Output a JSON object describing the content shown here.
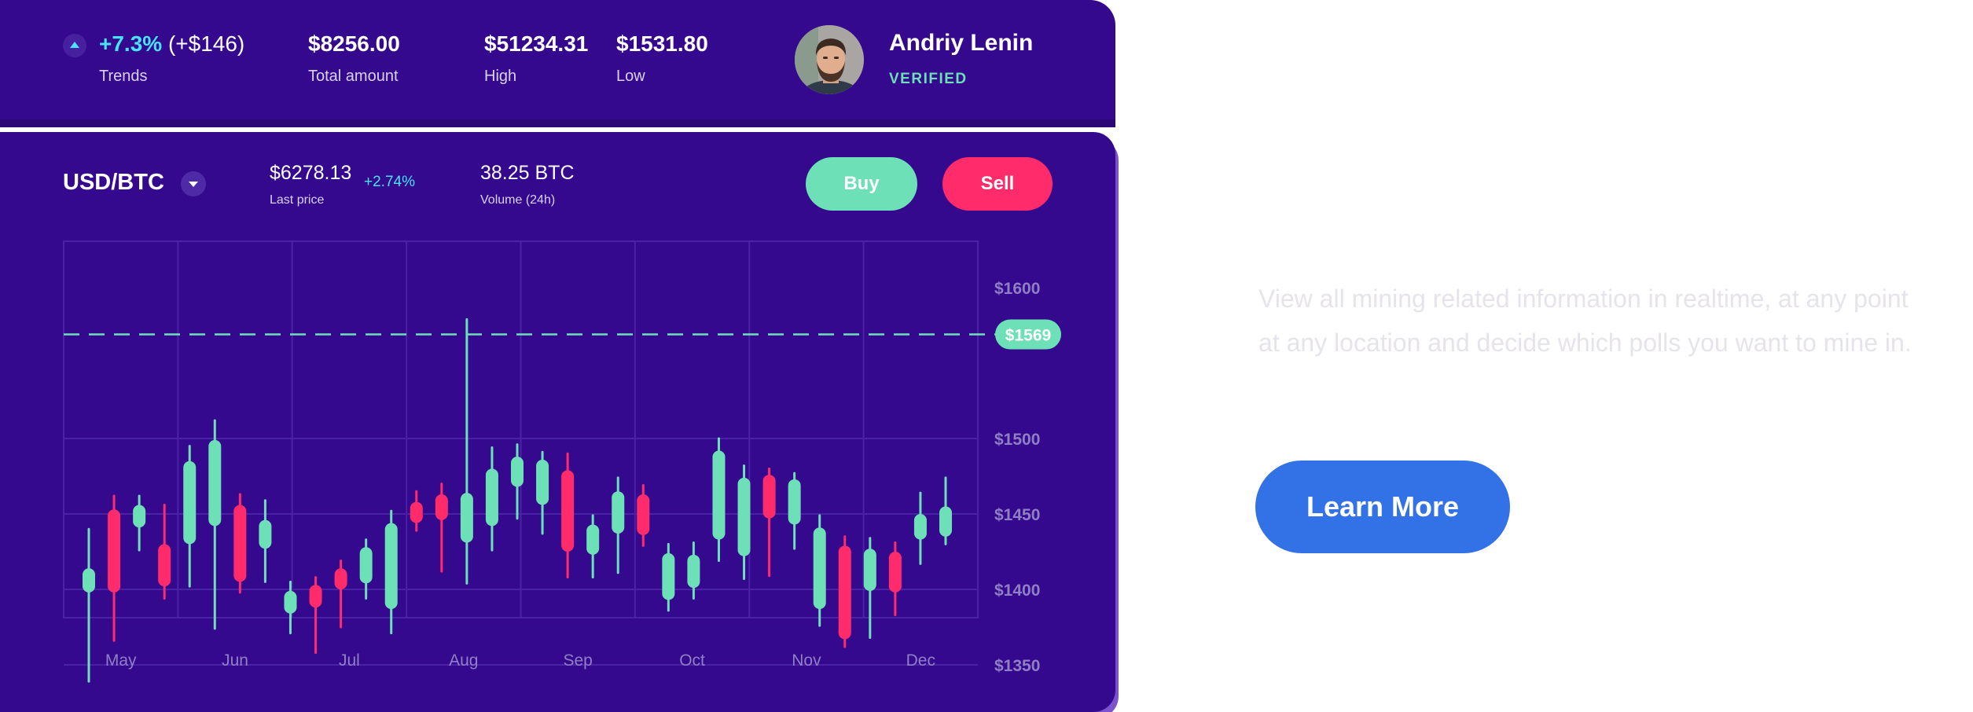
{
  "stats": {
    "trend_percent": "+7.3%",
    "trend_amount": "(+$146)",
    "trend_label": "Trends",
    "total_value": "$8256.00",
    "total_label": "Total amount",
    "high_value": "$51234.31",
    "high_label": "High",
    "low_value": "$1531.80",
    "low_label": "Low"
  },
  "user": {
    "name": "Andriy Lenin",
    "status": "VERIFIED"
  },
  "market": {
    "pair": "USD/BTC",
    "last_price": "$6278.13",
    "last_price_label": "Last price",
    "change": "+2.74%",
    "volume": "38.25 BTC",
    "volume_label": "Volume (24h)",
    "buy_label": "Buy",
    "sell_label": "Sell"
  },
  "colors": {
    "up": "#6ee0b7",
    "down": "#ff2b6a",
    "background": "#35098e",
    "accent": "#48e3ff",
    "cta": "#3371e6"
  },
  "chart_data": {
    "type": "candlestick",
    "ylim": [
      1350,
      1600
    ],
    "yticks": [
      "$1600",
      "$1500",
      "$1450",
      "$1400",
      "$1350"
    ],
    "ytick_values": [
      1600,
      1500,
      1450,
      1400,
      1350
    ],
    "xlabels": [
      "May",
      "Jun",
      "Jul",
      "Aug",
      "Sep",
      "Oct",
      "Nov",
      "Dec"
    ],
    "current_price": 1569,
    "current_price_label": "$1569",
    "grid": true,
    "candles": [
      {
        "up": true,
        "open": 1398,
        "close": 1414,
        "high": 1440,
        "low": 1339
      },
      {
        "up": false,
        "open": 1453,
        "close": 1398,
        "high": 1462,
        "low": 1366
      },
      {
        "up": true,
        "open": 1441,
        "close": 1456,
        "high": 1462,
        "low": 1426
      },
      {
        "up": false,
        "open": 1430,
        "close": 1402,
        "high": 1456,
        "low": 1394
      },
      {
        "up": true,
        "open": 1430,
        "close": 1485,
        "high": 1495,
        "low": 1402
      },
      {
        "up": true,
        "open": 1442,
        "close": 1499,
        "high": 1512,
        "low": 1374
      },
      {
        "up": false,
        "open": 1456,
        "close": 1405,
        "high": 1463,
        "low": 1398
      },
      {
        "up": true,
        "open": 1427,
        "close": 1446,
        "high": 1459,
        "low": 1405
      },
      {
        "up": true,
        "open": 1384,
        "close": 1399,
        "high": 1405,
        "low": 1371
      },
      {
        "up": false,
        "open": 1403,
        "close": 1388,
        "high": 1408,
        "low": 1358
      },
      {
        "up": false,
        "open": 1414,
        "close": 1400,
        "high": 1419,
        "low": 1375
      },
      {
        "up": true,
        "open": 1404,
        "close": 1428,
        "high": 1433,
        "low": 1394
      },
      {
        "up": true,
        "open": 1387,
        "close": 1444,
        "high": 1452,
        "low": 1371
      },
      {
        "up": false,
        "open": 1458,
        "close": 1444,
        "high": 1465,
        "low": 1439
      },
      {
        "up": false,
        "open": 1463,
        "close": 1446,
        "high": 1470,
        "low": 1412
      },
      {
        "up": true,
        "open": 1431,
        "close": 1464,
        "high": 1579,
        "low": 1404
      },
      {
        "up": true,
        "open": 1442,
        "close": 1480,
        "high": 1494,
        "low": 1426
      },
      {
        "up": true,
        "open": 1468,
        "close": 1488,
        "high": 1496,
        "low": 1447
      },
      {
        "up": true,
        "open": 1456,
        "close": 1486,
        "high": 1491,
        "low": 1437
      },
      {
        "up": false,
        "open": 1479,
        "close": 1425,
        "high": 1490,
        "low": 1408
      },
      {
        "up": true,
        "open": 1423,
        "close": 1443,
        "high": 1449,
        "low": 1408
      },
      {
        "up": true,
        "open": 1437,
        "close": 1465,
        "high": 1474,
        "low": 1411
      },
      {
        "up": false,
        "open": 1463,
        "close": 1436,
        "high": 1469,
        "low": 1429
      },
      {
        "up": true,
        "open": 1393,
        "close": 1424,
        "high": 1430,
        "low": 1386
      },
      {
        "up": true,
        "open": 1401,
        "close": 1423,
        "high": 1431,
        "low": 1394
      },
      {
        "up": true,
        "open": 1433,
        "close": 1492,
        "high": 1500,
        "low": 1419
      },
      {
        "up": true,
        "open": 1422,
        "close": 1474,
        "high": 1482,
        "low": 1407
      },
      {
        "up": false,
        "open": 1476,
        "close": 1447,
        "high": 1480,
        "low": 1409
      },
      {
        "up": true,
        "open": 1443,
        "close": 1473,
        "high": 1477,
        "low": 1427
      },
      {
        "up": true,
        "open": 1387,
        "close": 1441,
        "high": 1449,
        "low": 1376
      },
      {
        "up": false,
        "open": 1429,
        "close": 1367,
        "high": 1435,
        "low": 1362
      },
      {
        "up": true,
        "open": 1399,
        "close": 1427,
        "high": 1434,
        "low": 1368
      },
      {
        "up": false,
        "open": 1425,
        "close": 1398,
        "high": 1431,
        "low": 1383
      },
      {
        "up": true,
        "open": 1433,
        "close": 1450,
        "high": 1464,
        "low": 1417
      },
      {
        "up": true,
        "open": 1435,
        "close": 1455,
        "high": 1474,
        "low": 1430
      }
    ]
  },
  "hero": {
    "description": "View all mining related information in realtime, at any point at any location and decide which polls you want to mine in.",
    "cta_label": "Learn More"
  }
}
